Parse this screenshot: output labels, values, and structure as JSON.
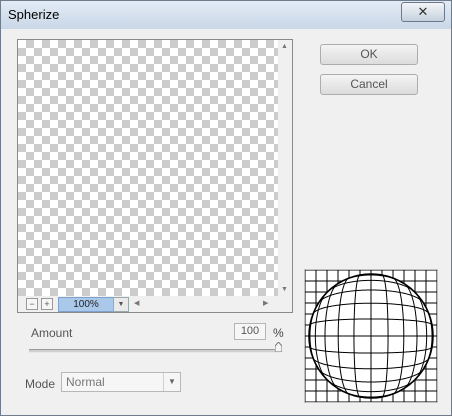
{
  "window": {
    "title": "Spherize",
    "close_glyph": "✕"
  },
  "preview": {
    "zoom_level": "100%",
    "zoom_out_glyph": "−",
    "zoom_in_glyph": "+",
    "dropdown_glyph": "▼",
    "scroll_up_glyph": "▲",
    "scroll_down_glyph": "▼",
    "scroll_left_glyph": "◀",
    "scroll_right_glyph": "▶"
  },
  "buttons": {
    "ok_label": "OK",
    "cancel_label": "Cancel"
  },
  "amount": {
    "label": "Amount",
    "value": "100",
    "unit": "%",
    "slider_fraction": 1.0
  },
  "mode": {
    "label": "Mode",
    "value": "Normal",
    "arrow_glyph": "▼"
  },
  "thumbnail": {
    "icon": "spherize-grid-icon"
  }
}
